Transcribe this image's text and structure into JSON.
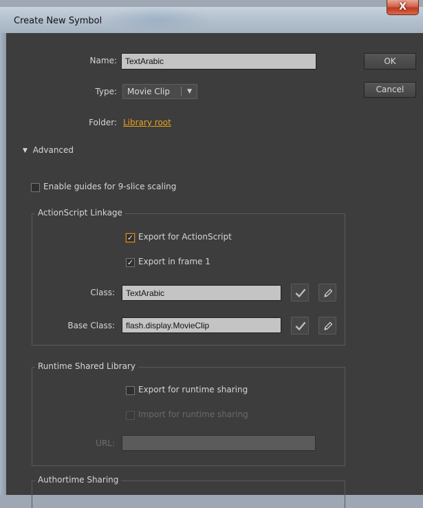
{
  "window": {
    "title": "Create New Symbol",
    "close_label": "X"
  },
  "form": {
    "name_label": "Name:",
    "name_value": "TextArabic",
    "type_label": "Type:",
    "type_value": "Movie Clip",
    "folder_label": "Folder:",
    "folder_value": "Library root"
  },
  "buttons": {
    "ok": "OK",
    "cancel": "Cancel"
  },
  "advanced": {
    "label": "Advanced",
    "expanded": true
  },
  "nine_slice": {
    "label": "Enable guides for 9-slice scaling",
    "checked": false
  },
  "actionscript": {
    "legend": "ActionScript Linkage",
    "export_as_label": "Export for ActionScript",
    "export_as_checked": true,
    "export_frame1_label": "Export in frame 1",
    "export_frame1_checked": true,
    "class_label": "Class:",
    "class_value": "TextArabic",
    "base_class_label": "Base Class:",
    "base_class_value": "flash.display.MovieClip"
  },
  "runtime": {
    "legend": "Runtime Shared Library",
    "export_label": "Export for runtime sharing",
    "export_checked": false,
    "import_label": "Import for runtime sharing",
    "import_checked": false,
    "url_label": "URL:",
    "url_value": ""
  },
  "authortime": {
    "legend": "Authortime Sharing"
  },
  "icons": {
    "check": "check-icon",
    "pencil": "pencil-icon",
    "triangle": "triangle-down-icon"
  }
}
